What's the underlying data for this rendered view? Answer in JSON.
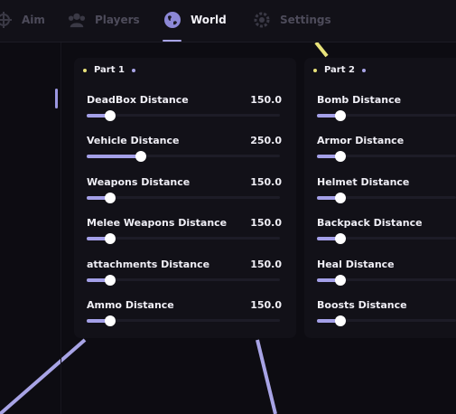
{
  "topbar": {
    "tabs": [
      {
        "label": "Aim",
        "icon": "crosshair-icon",
        "active": false
      },
      {
        "label": "Players",
        "icon": "users-icon",
        "active": false
      },
      {
        "label": "World",
        "icon": "globe-icon",
        "active": true
      },
      {
        "label": "Settings",
        "icon": "gear-icon",
        "active": false
      }
    ]
  },
  "colors": {
    "accent": "#a8a4e6",
    "dot_yellow": "#e8e27a",
    "panel": "#121118",
    "background": "#0d0c12"
  },
  "part1": {
    "title": "Part 1",
    "items": [
      {
        "label": "DeadBox Distance",
        "value": "150.0",
        "level": 0.12
      },
      {
        "label": "Vehicle Distance",
        "value": "250.0",
        "level": 0.28
      },
      {
        "label": "Weapons Distance",
        "value": "150.0",
        "level": 0.12
      },
      {
        "label": "Melee Weapons Distance",
        "value": "150.0",
        "level": 0.12
      },
      {
        "label": "attachments Distance",
        "value": "150.0",
        "level": 0.12
      },
      {
        "label": "Ammo Distance",
        "value": "150.0",
        "level": 0.12
      }
    ]
  },
  "part2": {
    "title": "Part 2",
    "items": [
      {
        "label": "Bomb Distance",
        "level": 0.12
      },
      {
        "label": "Armor Distance",
        "level": 0.12
      },
      {
        "label": "Helmet Distance",
        "level": 0.12
      },
      {
        "label": "Backpack Distance",
        "level": 0.12
      },
      {
        "label": "Heal Distance",
        "level": 0.12
      },
      {
        "label": "Boosts Distance",
        "level": 0.12
      }
    ]
  }
}
